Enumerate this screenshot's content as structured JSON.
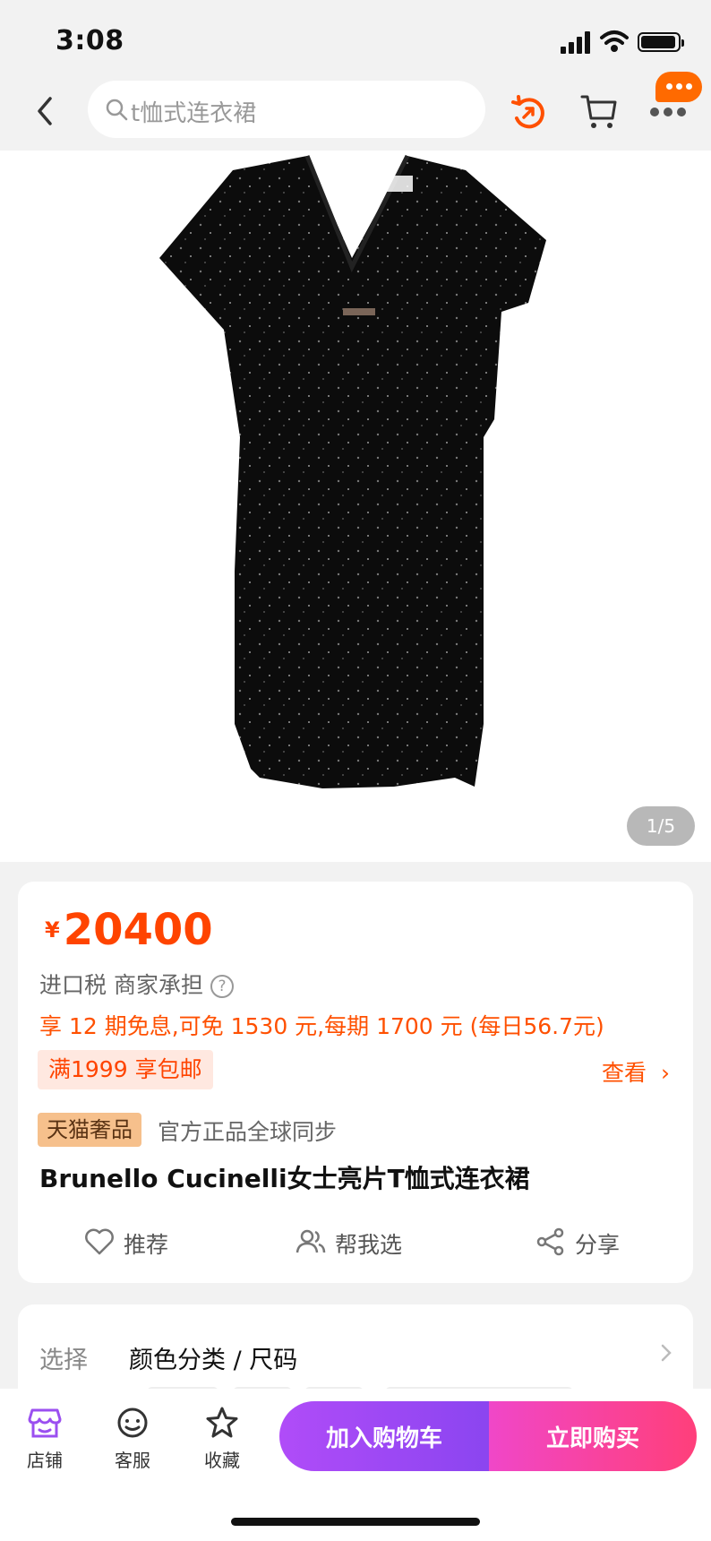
{
  "status": {
    "time": "3:08"
  },
  "nav": {
    "search_placeholder": "t恤式连衣裙"
  },
  "gallery": {
    "counter": "1/5"
  },
  "product": {
    "price_currency": "¥",
    "price": "20400",
    "tax": "进口税 商家承担",
    "tax_help": "?",
    "installment": "享 12 期免息,可免 1530 元,每期 1700 元 (每日56.7元)",
    "shipping": "满1999 享包邮",
    "view": "查看",
    "view_chevron": "›",
    "tmall_badge": "天猫奢品",
    "tmall_desc": "官方正品全球同步",
    "title": "Brunello Cucinelli女士亮片T恤式连衣裙"
  },
  "actions": {
    "recommend": "推荐",
    "help_choose": "帮我选",
    "share": "分享"
  },
  "selection": {
    "label": "选择",
    "value": "颜色分类 / 尺码"
  },
  "bottom": {
    "shop": "店铺",
    "service": "客服",
    "favorite": "收藏",
    "add_to_cart": "加入购物车",
    "buy_now": "立即购买"
  },
  "colors": {
    "accent": "#ff5000",
    "cart_gradient": [
      "#b04cf8",
      "#8b45f0"
    ],
    "buy_gradient": [
      "#f047c8",
      "#ff3f7a"
    ]
  }
}
